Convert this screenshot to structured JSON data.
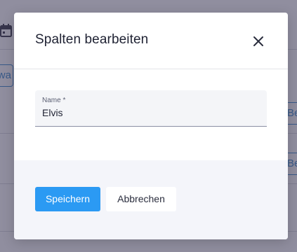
{
  "background": {
    "left_button_fragment": "ewa",
    "right_button_fragments": [
      "Be",
      "Be"
    ]
  },
  "dialog": {
    "title": "Spalten bearbeiten",
    "close_icon": "close-icon",
    "field": {
      "label": "Name *",
      "value": "Elvis"
    },
    "buttons": {
      "save": "Speichern",
      "cancel": "Abbrechen"
    }
  },
  "colors": {
    "overlay": "#403c5a",
    "primary": "#2b9af3",
    "footer_bg": "#f4f5fa",
    "field_bg": "#f4f5f8",
    "background_link": "#2f80c9"
  }
}
